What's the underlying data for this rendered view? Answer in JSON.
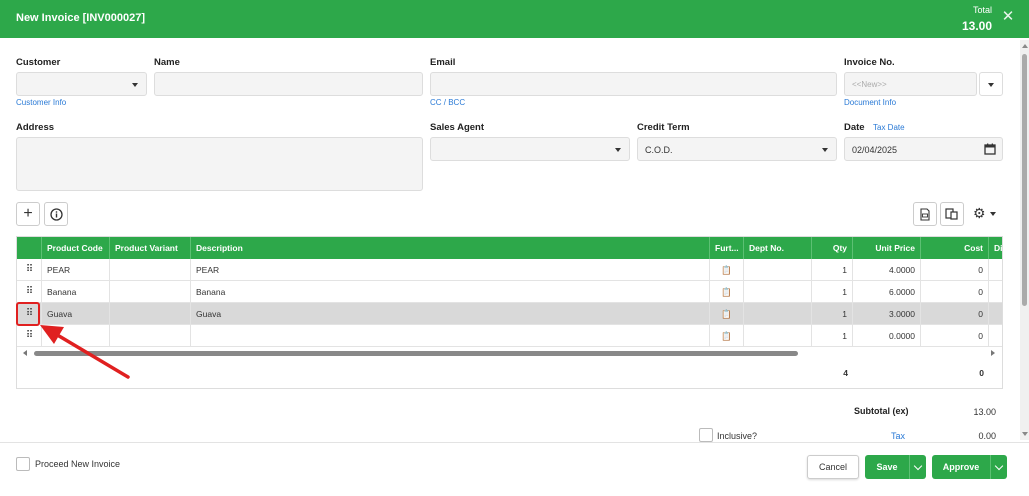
{
  "header": {
    "title": "New Invoice [INV000027]",
    "total_label": "Total",
    "total_value": "13.00"
  },
  "form": {
    "customer_label": "Customer",
    "customer_value": "",
    "customer_link": "Customer Info",
    "name_label": "Name",
    "name_value": "",
    "email_label": "Email",
    "email_value": "",
    "email_link": "CC / BCC",
    "invoice_no_label": "Invoice No.",
    "invoice_no_placeholder": "<<New>>",
    "invoice_link": "Document Info",
    "address_label": "Address",
    "address_value": "",
    "sales_agent_label": "Sales Agent",
    "sales_agent_value": "",
    "credit_term_label": "Credit Term",
    "credit_term_value": "C.O.D.",
    "date_label": "Date",
    "tax_date_link": "Tax Date",
    "date_value": "02/04/2025"
  },
  "grid": {
    "columns": [
      "Product Code",
      "Product Variant",
      "Description",
      "Furt...",
      "Dept No.",
      "Qty",
      "Unit Price",
      "Cost",
      "Dis"
    ],
    "rows": [
      {
        "code": "PEAR",
        "variant": "",
        "description": "PEAR",
        "dept": "",
        "qty": "1",
        "unit_price": "4.0000",
        "cost": "0"
      },
      {
        "code": "Banana",
        "variant": "",
        "description": "Banana",
        "dept": "",
        "qty": "1",
        "unit_price": "6.0000",
        "cost": "0"
      },
      {
        "code": "Guava",
        "variant": "",
        "description": "Guava",
        "dept": "",
        "qty": "1",
        "unit_price": "3.0000",
        "cost": "0"
      },
      {
        "code": "",
        "variant": "",
        "description": "",
        "dept": "",
        "qty": "1",
        "unit_price": "0.0000",
        "cost": "0"
      }
    ],
    "totals": {
      "qty": "4",
      "cost": "0"
    }
  },
  "summary": {
    "subtotal_label": "Subtotal (ex)",
    "subtotal_value": "13.00",
    "inclusive_label": "Inclusive?",
    "tax_label": "Tax",
    "tax_value": "0.00"
  },
  "footer": {
    "proceed_label": "Proceed New Invoice",
    "cancel_label": "Cancel",
    "save_label": "Save",
    "approve_label": "Approve"
  },
  "colors": {
    "brand_green": "#2da84a",
    "link_blue": "#2a7ad6",
    "highlight_red": "#e02020"
  },
  "icons": [
    "close-icon",
    "add-icon",
    "info-icon",
    "dropdown-caret-icon",
    "calendar-icon",
    "drag-handle-icon",
    "clipboard-icon",
    "export-icon",
    "copy-icon",
    "gear-icon",
    "chevron-down-icon",
    "annotation-arrow"
  ]
}
